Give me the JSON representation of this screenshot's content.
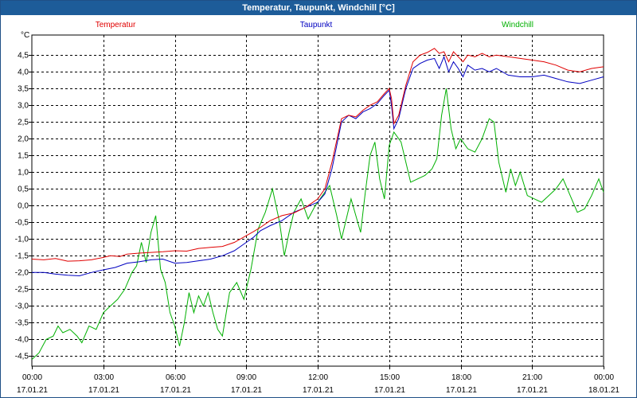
{
  "window": {
    "title": "Temperatur, Taupunkt, Windchill [°C]"
  },
  "chart_data": {
    "type": "line",
    "unit_label": "°C",
    "ylim": [
      -4.8,
      5.1
    ],
    "xlim": [
      0,
      24
    ],
    "grid": true,
    "legend_position": "top",
    "y_ticks": [
      {
        "v": 4.5,
        "label": "4,5"
      },
      {
        "v": 4.0,
        "label": "4,0"
      },
      {
        "v": 3.5,
        "label": "3,5"
      },
      {
        "v": 3.0,
        "label": "3,0"
      },
      {
        "v": 2.5,
        "label": "2,5"
      },
      {
        "v": 2.0,
        "label": "2,0"
      },
      {
        "v": 1.5,
        "label": "1,5"
      },
      {
        "v": 1.0,
        "label": "1,0"
      },
      {
        "v": 0.5,
        "label": "0,5"
      },
      {
        "v": 0.0,
        "label": "0,0"
      },
      {
        "v": -0.5,
        "label": "-0,5"
      },
      {
        "v": -1.0,
        "label": "-1,0"
      },
      {
        "v": -1.5,
        "label": "-1,5"
      },
      {
        "v": -2.0,
        "label": "-2,0"
      },
      {
        "v": -2.5,
        "label": "-2,5"
      },
      {
        "v": -3.0,
        "label": "-3,0"
      },
      {
        "v": -3.5,
        "label": "-3,5"
      },
      {
        "v": -4.0,
        "label": "-4,0"
      },
      {
        "v": -4.5,
        "label": "-4,5"
      }
    ],
    "x_ticks": [
      {
        "h": 0,
        "time": "00:00",
        "date": "17.01.21"
      },
      {
        "h": 3,
        "time": "03:00",
        "date": "17.01.21"
      },
      {
        "h": 6,
        "time": "06:00",
        "date": "17.01.21"
      },
      {
        "h": 9,
        "time": "09:00",
        "date": "17.01.21"
      },
      {
        "h": 12,
        "time": "12:00",
        "date": "17.01.21"
      },
      {
        "h": 15,
        "time": "15:00",
        "date": "17.01.21"
      },
      {
        "h": 18,
        "time": "18:00",
        "date": "17.01.21"
      },
      {
        "h": 21,
        "time": "21:00",
        "date": "17.01.21"
      },
      {
        "h": 24,
        "time": "00:00",
        "date": "18.01.21"
      }
    ],
    "series": [
      {
        "name": "Temperatur",
        "color": "#e00000",
        "points": [
          [
            0,
            -1.6
          ],
          [
            0.5,
            -1.62
          ],
          [
            1,
            -1.58
          ],
          [
            1.5,
            -1.66
          ],
          [
            2,
            -1.65
          ],
          [
            2.5,
            -1.62
          ],
          [
            3,
            -1.55
          ],
          [
            3.3,
            -1.5
          ],
          [
            3.7,
            -1.52
          ],
          [
            4,
            -1.45
          ],
          [
            4.5,
            -1.42
          ],
          [
            5,
            -1.4
          ],
          [
            5.5,
            -1.38
          ],
          [
            6,
            -1.35
          ],
          [
            6.5,
            -1.36
          ],
          [
            7,
            -1.28
          ],
          [
            7.5,
            -1.25
          ],
          [
            8,
            -1.22
          ],
          [
            8.5,
            -1.1
          ],
          [
            9,
            -0.9
          ],
          [
            9.3,
            -0.78
          ],
          [
            9.6,
            -0.65
          ],
          [
            10,
            -0.45
          ],
          [
            10.5,
            -0.3
          ],
          [
            11,
            -0.22
          ],
          [
            11.5,
            -0.05
          ],
          [
            12,
            0.2
          ],
          [
            12.3,
            0.5
          ],
          [
            12.6,
            1.3
          ],
          [
            13,
            2.6
          ],
          [
            13.3,
            2.7
          ],
          [
            13.6,
            2.65
          ],
          [
            13.9,
            2.85
          ],
          [
            14.2,
            3.0
          ],
          [
            14.5,
            3.1
          ],
          [
            14.8,
            3.35
          ],
          [
            15.0,
            3.5
          ],
          [
            15.1,
            3.2
          ],
          [
            15.2,
            2.45
          ],
          [
            15.4,
            2.7
          ],
          [
            15.7,
            3.6
          ],
          [
            16,
            4.3
          ],
          [
            16.3,
            4.5
          ],
          [
            16.6,
            4.58
          ],
          [
            16.9,
            4.7
          ],
          [
            17.1,
            4.55
          ],
          [
            17.3,
            4.6
          ],
          [
            17.5,
            4.3
          ],
          [
            17.7,
            4.6
          ],
          [
            17.9,
            4.45
          ],
          [
            18.1,
            4.3
          ],
          [
            18.3,
            4.5
          ],
          [
            18.6,
            4.45
          ],
          [
            18.9,
            4.55
          ],
          [
            19.2,
            4.45
          ],
          [
            19.5,
            4.5
          ],
          [
            20,
            4.45
          ],
          [
            20.5,
            4.4
          ],
          [
            21,
            4.35
          ],
          [
            21.5,
            4.3
          ],
          [
            22,
            4.2
          ],
          [
            22.5,
            4.05
          ],
          [
            23,
            4.0
          ],
          [
            23.5,
            4.1
          ],
          [
            24,
            4.15
          ]
        ]
      },
      {
        "name": "Taupunkt",
        "color": "#0000c0",
        "points": [
          [
            0,
            -2.0
          ],
          [
            0.5,
            -2.0
          ],
          [
            1,
            -2.05
          ],
          [
            1.5,
            -2.08
          ],
          [
            2,
            -2.1
          ],
          [
            2.5,
            -2.0
          ],
          [
            3,
            -1.92
          ],
          [
            3.5,
            -1.85
          ],
          [
            4,
            -1.72
          ],
          [
            4.5,
            -1.68
          ],
          [
            5,
            -1.62
          ],
          [
            5.5,
            -1.6
          ],
          [
            6,
            -1.72
          ],
          [
            6.5,
            -1.7
          ],
          [
            7,
            -1.65
          ],
          [
            7.5,
            -1.6
          ],
          [
            8,
            -1.5
          ],
          [
            8.5,
            -1.35
          ],
          [
            9,
            -1.1
          ],
          [
            9.3,
            -0.95
          ],
          [
            9.6,
            -0.75
          ],
          [
            10,
            -0.6
          ],
          [
            10.5,
            -0.45
          ],
          [
            11,
            -0.2
          ],
          [
            11.5,
            -0.05
          ],
          [
            12,
            0.1
          ],
          [
            12.3,
            0.35
          ],
          [
            12.6,
            1.1
          ],
          [
            13,
            2.5
          ],
          [
            13.3,
            2.7
          ],
          [
            13.6,
            2.6
          ],
          [
            13.9,
            2.8
          ],
          [
            14.2,
            2.9
          ],
          [
            14.5,
            3.05
          ],
          [
            14.8,
            3.3
          ],
          [
            15.0,
            3.45
          ],
          [
            15.1,
            3.0
          ],
          [
            15.2,
            2.3
          ],
          [
            15.4,
            2.6
          ],
          [
            15.7,
            3.5
          ],
          [
            16,
            4.1
          ],
          [
            16.3,
            4.25
          ],
          [
            16.6,
            4.35
          ],
          [
            16.9,
            4.4
          ],
          [
            17.1,
            4.1
          ],
          [
            17.3,
            4.45
          ],
          [
            17.5,
            4.0
          ],
          [
            17.7,
            4.3
          ],
          [
            17.9,
            4.1
          ],
          [
            18.1,
            3.85
          ],
          [
            18.3,
            4.2
          ],
          [
            18.6,
            4.05
          ],
          [
            18.9,
            4.1
          ],
          [
            19.2,
            4.0
          ],
          [
            19.5,
            4.1
          ],
          [
            20,
            3.9
          ],
          [
            20.5,
            3.85
          ],
          [
            21,
            3.85
          ],
          [
            21.5,
            3.9
          ],
          [
            22,
            3.8
          ],
          [
            22.5,
            3.7
          ],
          [
            23,
            3.65
          ],
          [
            23.5,
            3.75
          ],
          [
            24,
            3.85
          ]
        ]
      },
      {
        "name": "Windchill",
        "color": "#00b000",
        "points": [
          [
            0,
            -4.6
          ],
          [
            0.3,
            -4.4
          ],
          [
            0.6,
            -4.0
          ],
          [
            0.9,
            -3.9
          ],
          [
            1.1,
            -3.6
          ],
          [
            1.3,
            -3.8
          ],
          [
            1.6,
            -3.7
          ],
          [
            1.9,
            -3.9
          ],
          [
            2.1,
            -4.1
          ],
          [
            2.4,
            -3.6
          ],
          [
            2.7,
            -3.7
          ],
          [
            3.0,
            -3.2
          ],
          [
            3.3,
            -3.0
          ],
          [
            3.6,
            -2.8
          ],
          [
            3.9,
            -2.5
          ],
          [
            4.2,
            -2.0
          ],
          [
            4.4,
            -1.8
          ],
          [
            4.6,
            -1.1
          ],
          [
            4.8,
            -1.7
          ],
          [
            5.0,
            -0.8
          ],
          [
            5.2,
            -0.3
          ],
          [
            5.4,
            -1.9
          ],
          [
            5.6,
            -2.3
          ],
          [
            5.8,
            -3.2
          ],
          [
            6.0,
            -3.6
          ],
          [
            6.2,
            -4.2
          ],
          [
            6.4,
            -3.5
          ],
          [
            6.6,
            -2.6
          ],
          [
            6.8,
            -3.2
          ],
          [
            7.0,
            -2.7
          ],
          [
            7.2,
            -3.0
          ],
          [
            7.4,
            -2.6
          ],
          [
            7.6,
            -3.2
          ],
          [
            7.8,
            -3.7
          ],
          [
            8.0,
            -3.9
          ],
          [
            8.3,
            -2.6
          ],
          [
            8.6,
            -2.3
          ],
          [
            8.9,
            -2.8
          ],
          [
            9.2,
            -1.9
          ],
          [
            9.5,
            -0.7
          ],
          [
            9.8,
            -0.2
          ],
          [
            10.1,
            0.5
          ],
          [
            10.4,
            -0.5
          ],
          [
            10.6,
            -1.5
          ],
          [
            10.8,
            -0.8
          ],
          [
            11.0,
            -0.2
          ],
          [
            11.3,
            0.2
          ],
          [
            11.6,
            -0.4
          ],
          [
            11.9,
            0.0
          ],
          [
            12.2,
            0.3
          ],
          [
            12.5,
            0.6
          ],
          [
            12.8,
            -0.3
          ],
          [
            13.0,
            -1.0
          ],
          [
            13.2,
            -0.4
          ],
          [
            13.4,
            0.2
          ],
          [
            13.6,
            -0.3
          ],
          [
            13.8,
            -0.8
          ],
          [
            14.0,
            0.4
          ],
          [
            14.2,
            1.5
          ],
          [
            14.4,
            1.9
          ],
          [
            14.6,
            0.8
          ],
          [
            14.8,
            0.2
          ],
          [
            15.0,
            1.8
          ],
          [
            15.2,
            2.2
          ],
          [
            15.5,
            1.9
          ],
          [
            15.7,
            1.3
          ],
          [
            15.9,
            0.7
          ],
          [
            16.2,
            0.8
          ],
          [
            16.5,
            0.9
          ],
          [
            16.8,
            1.1
          ],
          [
            17.0,
            1.4
          ],
          [
            17.2,
            2.7
          ],
          [
            17.4,
            3.5
          ],
          [
            17.6,
            2.3
          ],
          [
            17.8,
            1.7
          ],
          [
            18.0,
            2.0
          ],
          [
            18.3,
            1.7
          ],
          [
            18.6,
            1.6
          ],
          [
            18.9,
            2.0
          ],
          [
            19.2,
            2.6
          ],
          [
            19.4,
            2.5
          ],
          [
            19.6,
            1.3
          ],
          [
            19.9,
            0.4
          ],
          [
            20.1,
            1.1
          ],
          [
            20.3,
            0.6
          ],
          [
            20.5,
            1.0
          ],
          [
            20.8,
            0.3
          ],
          [
            21.1,
            0.2
          ],
          [
            21.4,
            0.1
          ],
          [
            21.7,
            0.3
          ],
          [
            22.0,
            0.5
          ],
          [
            22.3,
            0.8
          ],
          [
            22.6,
            0.3
          ],
          [
            22.9,
            -0.2
          ],
          [
            23.2,
            -0.1
          ],
          [
            23.5,
            0.3
          ],
          [
            23.8,
            0.8
          ],
          [
            24.0,
            0.4
          ]
        ]
      }
    ]
  }
}
